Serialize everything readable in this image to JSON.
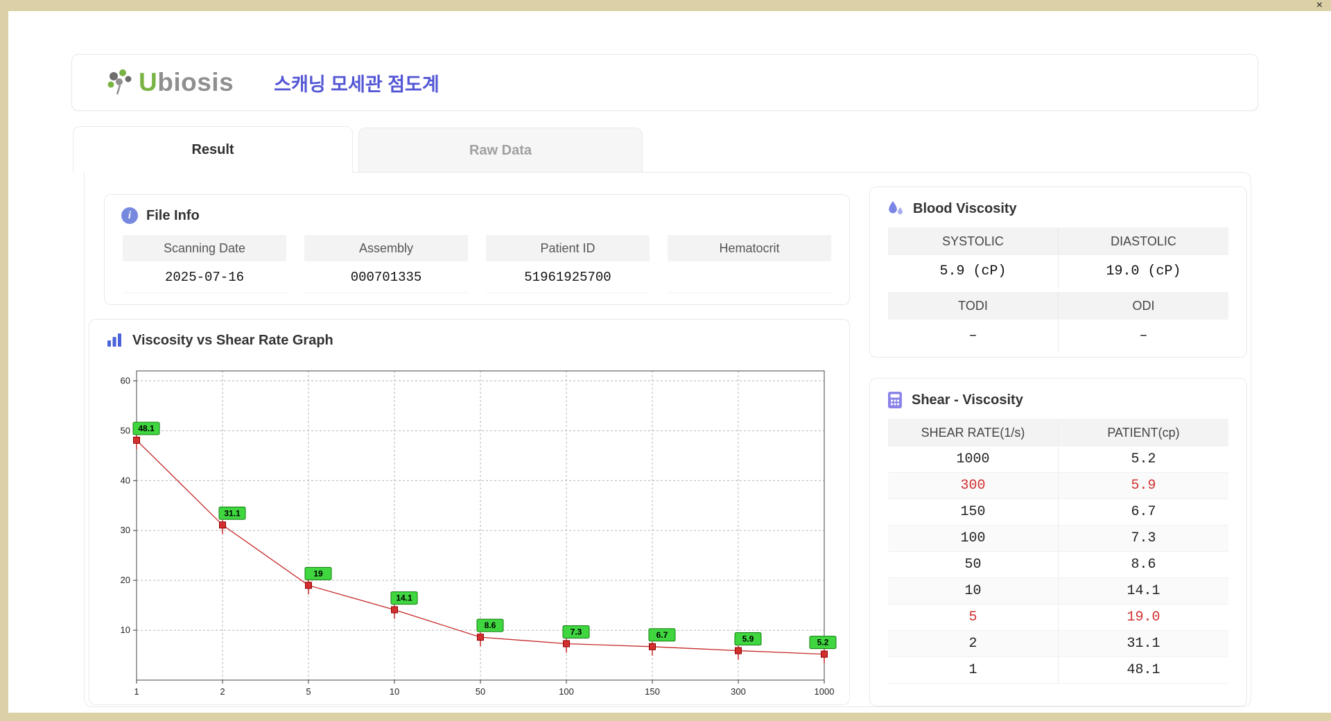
{
  "window": {
    "close_label": "×"
  },
  "header": {
    "logo_u": "U",
    "logo_rest": "biosis",
    "title": "스캐닝 모세관 점도계"
  },
  "tabs": {
    "result": "Result",
    "raw_data": "Raw Data"
  },
  "file_info": {
    "title": "File Info",
    "fields": [
      {
        "label": "Scanning Date",
        "value": "2025-07-16"
      },
      {
        "label": "Assembly",
        "value": "000701335"
      },
      {
        "label": "Patient ID",
        "value": "51961925700"
      },
      {
        "label": "Hematocrit",
        "value": ""
      }
    ]
  },
  "graph": {
    "title": "Viscosity vs Shear Rate Graph"
  },
  "chart_data": {
    "type": "line",
    "title": "Viscosity vs Shear Rate Graph",
    "x_scale": "category",
    "x": [
      "1",
      "2",
      "5",
      "10",
      "50",
      "100",
      "150",
      "300",
      "1000"
    ],
    "values": [
      48.1,
      31.1,
      19,
      14.1,
      8.6,
      7.3,
      6.7,
      5.9,
      5.2
    ],
    "point_labels": [
      "48.1",
      "31.1",
      "19",
      "14.1",
      "8.6",
      "7.3",
      "6.7",
      "5.9",
      "5.2"
    ],
    "xlabel": "",
    "ylabel": "",
    "y_ticks": [
      10,
      20,
      30,
      40,
      50,
      60
    ],
    "ylim": [
      0,
      62
    ],
    "grid": true,
    "legend": "none",
    "line_color": "#c62828",
    "marker_color": "#d32f2f",
    "marker_edge": "#8e0000",
    "label_bg": "#3fd63f",
    "label_border": "#0f7d0f"
  },
  "blood_viscosity": {
    "title": "Blood Viscosity",
    "rows": [
      {
        "headers": [
          "SYSTOLIC",
          "DIASTOLIC"
        ],
        "values": [
          "5.9 (cP)",
          "19.0 (cP)"
        ]
      },
      {
        "headers": [
          "TODI",
          "ODI"
        ],
        "values": [
          "–",
          "–"
        ]
      }
    ]
  },
  "shear_viscosity": {
    "title": "Shear - Viscosity",
    "columns": [
      "SHEAR RATE(1/s)",
      "PATIENT(cp)"
    ],
    "rows": [
      {
        "rate": "1000",
        "value": "5.2",
        "highlight": false
      },
      {
        "rate": "300",
        "value": "5.9",
        "highlight": true
      },
      {
        "rate": "150",
        "value": "6.7",
        "highlight": false
      },
      {
        "rate": "100",
        "value": "7.3",
        "highlight": false
      },
      {
        "rate": "50",
        "value": "8.6",
        "highlight": false
      },
      {
        "rate": "10",
        "value": "14.1",
        "highlight": false
      },
      {
        "rate": "5",
        "value": "19.0",
        "highlight": true
      },
      {
        "rate": "2",
        "value": "31.1",
        "highlight": false
      },
      {
        "rate": "1",
        "value": "48.1",
        "highlight": false
      }
    ]
  }
}
